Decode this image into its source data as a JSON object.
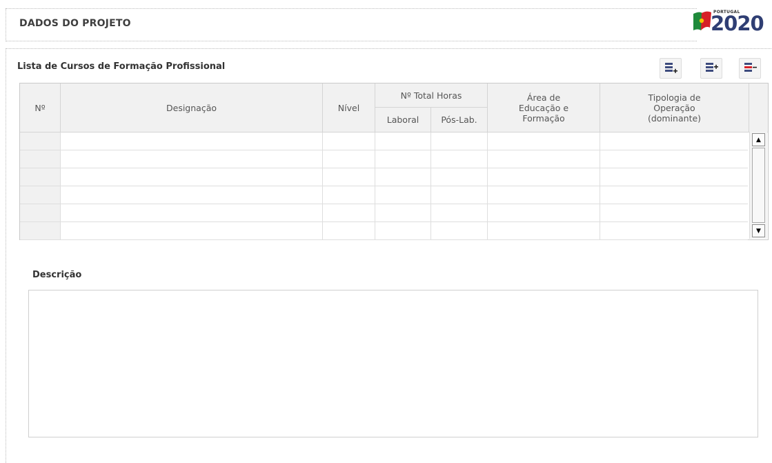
{
  "header": {
    "title": "DADOS DO PROJETO"
  },
  "logo": {
    "country": "PORTUGAL",
    "year": "2020",
    "colors": {
      "green": "#1f8a3b",
      "red": "#d62027",
      "text": "#2f3e73"
    }
  },
  "list": {
    "title": "Lista de Cursos de Formação Profissional",
    "toolbar": [
      {
        "icon": "add-row-icon"
      },
      {
        "icon": "insert-row-icon"
      },
      {
        "icon": "delete-row-icon"
      }
    ]
  },
  "table": {
    "columns": {
      "num": "Nº",
      "designacao": "Designação",
      "nivel": "Nível",
      "horas_group": "Nº Total Horas",
      "laboral": "Laboral",
      "pos_laboral": "Pós-Lab.",
      "area": "Área de Educação e Formação",
      "tipologia": "Tipologia de Operação (dominante)"
    },
    "rows": [
      {
        "num": "",
        "designacao": "",
        "nivel": "",
        "laboral": "",
        "pos_laboral": "",
        "area": "",
        "tipologia": ""
      },
      {
        "num": "",
        "designacao": "",
        "nivel": "",
        "laboral": "",
        "pos_laboral": "",
        "area": "",
        "tipologia": ""
      },
      {
        "num": "",
        "designacao": "",
        "nivel": "",
        "laboral": "",
        "pos_laboral": "",
        "area": "",
        "tipologia": ""
      },
      {
        "num": "",
        "designacao": "",
        "nivel": "",
        "laboral": "",
        "pos_laboral": "",
        "area": "",
        "tipologia": ""
      },
      {
        "num": "",
        "designacao": "",
        "nivel": "",
        "laboral": "",
        "pos_laboral": "",
        "area": "",
        "tipologia": ""
      },
      {
        "num": "",
        "designacao": "",
        "nivel": "",
        "laboral": "",
        "pos_laboral": "",
        "area": "",
        "tipologia": ""
      }
    ]
  },
  "descricao": {
    "label": "Descrição",
    "value": ""
  }
}
